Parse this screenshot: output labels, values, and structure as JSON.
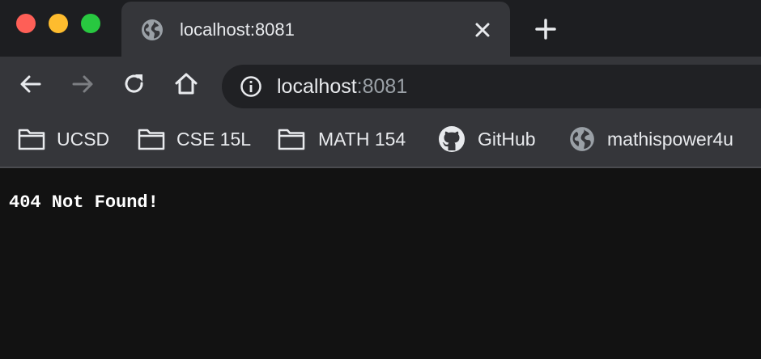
{
  "window": {
    "controls": [
      "close",
      "minimize",
      "zoom"
    ]
  },
  "tab": {
    "title": "localhost:8081",
    "favicon": "globe-icon",
    "close_icon": "close-icon"
  },
  "new_tab_icon": "plus-icon",
  "nav": {
    "back_icon": "arrow-left-icon",
    "forward_icon": "arrow-right-icon",
    "forward_enabled": false,
    "reload_icon": "reload-icon",
    "home_icon": "home-icon"
  },
  "omnibox": {
    "info_icon": "info-icon",
    "url_host": "localhost",
    "url_port": ":8081"
  },
  "bookmarks": [
    {
      "label": "UCSD",
      "icon": "folder-icon"
    },
    {
      "label": "CSE 15L",
      "icon": "folder-icon"
    },
    {
      "label": "MATH 154",
      "icon": "folder-icon"
    },
    {
      "label": "GitHub",
      "icon": "github-icon"
    },
    {
      "label": "mathispower4u",
      "icon": "globe-icon"
    }
  ],
  "page": {
    "message": "404 Not Found!"
  },
  "colors": {
    "tabstrip": "#1d1e21",
    "toolbar": "#35363a",
    "omnibox": "#202124",
    "content_bg": "#121212",
    "text": "#e8eaed",
    "muted_text": "#9aa0a6",
    "traffic_red": "#fe5f57",
    "traffic_yellow": "#febc2e",
    "traffic_green": "#28c840"
  }
}
